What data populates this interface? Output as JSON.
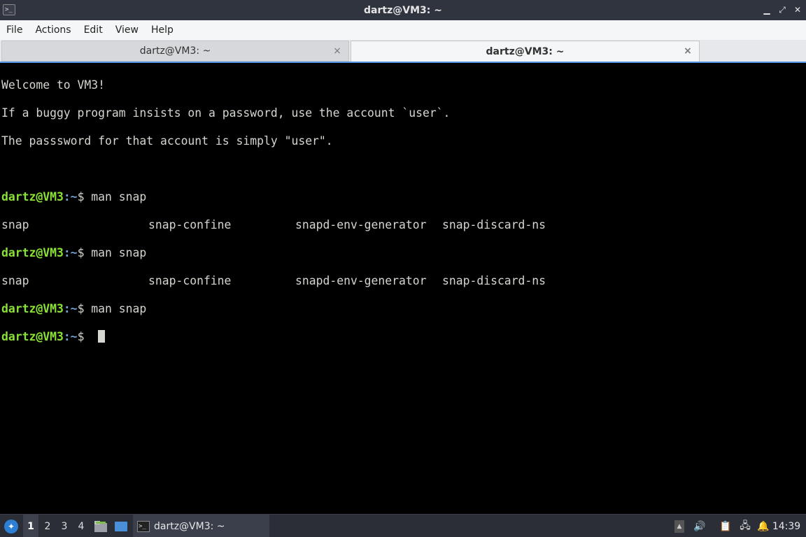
{
  "window": {
    "title": "dartz@VM3: ~",
    "min_glyph": "▁",
    "max_glyph": "⤢",
    "close_glyph": "✕",
    "app_icon_glyph": ">_"
  },
  "menu": [
    "File",
    "Actions",
    "Edit",
    "View",
    "Help"
  ],
  "tabs": [
    {
      "label": "dartz@VM3: ~",
      "close": "×"
    },
    {
      "label": "dartz@VM3: ~",
      "close": "×"
    }
  ],
  "terminal": {
    "welcome": [
      "Welcome to VM3!",
      "If a buggy program insists on a password, use the account `user`.",
      "The passsword for that account is simply \"user\"."
    ],
    "prompt_user": "dartz@VM3",
    "prompt_path": ":~",
    "prompt_sign": "$",
    "command": " man snap",
    "completions": [
      "snap",
      "snap-confine",
      "snapd-env-generator",
      "snap-discard-ns"
    ]
  },
  "taskbar": {
    "start_glyph": "✦",
    "workspaces": [
      "1",
      "2",
      "3",
      "4"
    ],
    "task_label": "dartz@VM3: ~",
    "task_icon_glyph": ">_",
    "tray": {
      "up_glyph": "▲",
      "volume_glyph": "🔊",
      "clipboard_glyph": "📋",
      "network_glyph": "🖧",
      "notify_glyph": "🔔"
    },
    "clock": "14:39"
  }
}
